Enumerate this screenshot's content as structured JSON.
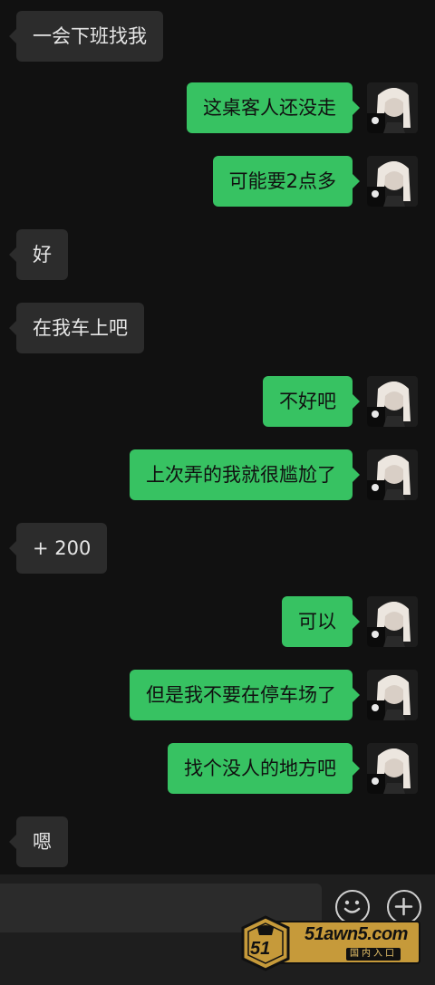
{
  "messages": [
    {
      "side": "left",
      "text": "一会下班找我"
    },
    {
      "side": "right",
      "text": "这桌客人还没走"
    },
    {
      "side": "right",
      "text": "可能要2点多"
    },
    {
      "side": "left",
      "text": "好"
    },
    {
      "side": "left",
      "text": "在我车上吧"
    },
    {
      "side": "right",
      "text": "不好吧"
    },
    {
      "side": "right",
      "text": "上次弄的我就很尴尬了"
    },
    {
      "side": "left",
      "text": "+ 200"
    },
    {
      "side": "right",
      "text": "可以"
    },
    {
      "side": "right",
      "text": "但是我不要在停车场了"
    },
    {
      "side": "right",
      "text": "找个没人的地方吧"
    },
    {
      "side": "left",
      "text": "嗯"
    }
  ],
  "input_bar": {
    "emoji_icon": "smiley-face-icon",
    "add_icon": "plus-circle-icon"
  },
  "watermark": {
    "title": "51awn5.com",
    "subtitle": "国内入口",
    "badge": "51"
  },
  "colors": {
    "background": "#111111",
    "bubble_left": "#2c2c2c",
    "bubble_right": "#37c262",
    "watermark_gold": "#c69a3a"
  }
}
